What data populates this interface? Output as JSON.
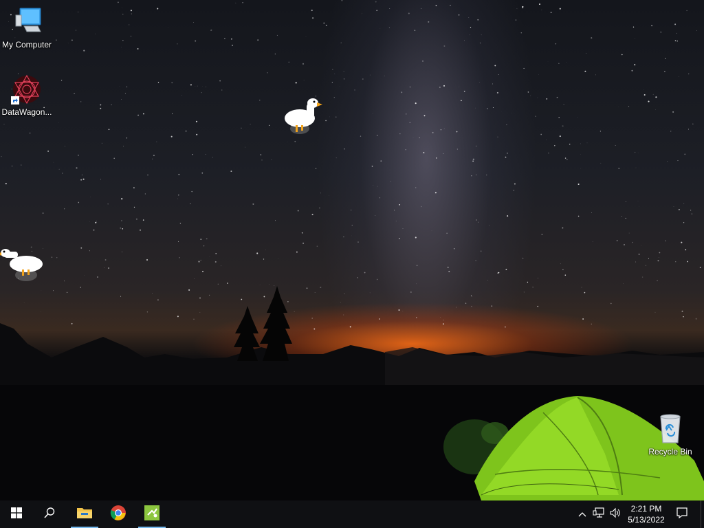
{
  "desktop": {
    "icons": [
      {
        "label": "My Computer",
        "icon": "computer-monitor-icon"
      },
      {
        "label": "DataWagon...",
        "icon": "datawagon-app-icon"
      },
      {
        "label": "Recycle Bin",
        "icon": "recycle-bin-icon"
      }
    ],
    "geese": [
      "goose-sprite",
      "goose-sprite"
    ],
    "wallpaper": "night-sky-milky-way-tent"
  },
  "taskbar": {
    "start": {
      "icon": "windows-logo-icon"
    },
    "search": {
      "icon": "search-icon"
    },
    "pinned": [
      {
        "name": "File Explorer",
        "icon": "folder-icon",
        "active": true
      },
      {
        "name": "Google Chrome",
        "icon": "chrome-icon",
        "active": false
      },
      {
        "name": "Image viewer",
        "icon": "photo-app-icon",
        "active": true
      }
    ],
    "tray": {
      "icons": [
        "chevron-up-icon",
        "network-icon",
        "volume-icon"
      ],
      "time": "2:21 PM",
      "date": "5/13/2022",
      "notifications_icon": "action-center-icon"
    },
    "accent": "#76b9ed",
    "background": "#0f1013"
  }
}
